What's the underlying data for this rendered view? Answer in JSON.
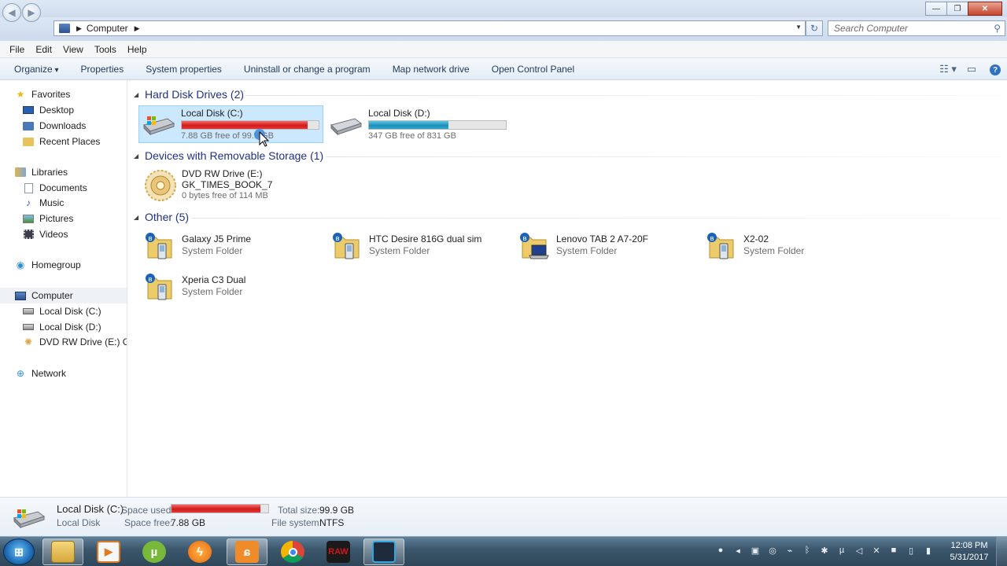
{
  "window": {
    "minimize": "—",
    "restore": "❐",
    "close": "✕"
  },
  "address": {
    "crumb": "Computer",
    "back": "◀",
    "forward": "▶",
    "refresh": "↻",
    "search_placeholder": "Search Computer"
  },
  "menu": [
    "File",
    "Edit",
    "View",
    "Tools",
    "Help"
  ],
  "toolbar": {
    "organize": "Organize",
    "commands": [
      "Properties",
      "System properties",
      "Uninstall or change a program",
      "Map network drive",
      "Open Control Panel"
    ]
  },
  "nav": {
    "favorites": "Favorites",
    "desktop": "Desktop",
    "downloads": "Downloads",
    "recent": "Recent Places",
    "libraries": "Libraries",
    "documents": "Documents",
    "music": "Music",
    "pictures": "Pictures",
    "videos": "Videos",
    "homegroup": "Homegroup",
    "computer": "Computer",
    "disk_c": "Local Disk (C:)",
    "disk_d": "Local Disk (D:)",
    "dvd": "DVD RW Drive (E:) GK_T",
    "network": "Network"
  },
  "groups": {
    "hdd": "Hard Disk Drives (2)",
    "removable": "Devices with Removable Storage (1)",
    "other": "Other (5)"
  },
  "drives": [
    {
      "name": "Local Disk (C:)",
      "free": "7.88 GB free of 99.9 GB",
      "used_fraction": 0.92,
      "bar_color": "#d21a1a"
    },
    {
      "name": "Local Disk (D:)",
      "free": "347 GB free of 831 GB",
      "used_fraction": 0.58,
      "bar_color": "#1d8fb8"
    }
  ],
  "dvd": {
    "line1": "DVD RW Drive (E:)",
    "line2": "GK_TIMES_BOOK_7",
    "line3": "0 bytes free of 114 MB"
  },
  "other_items": [
    {
      "name": "Galaxy J5 Prime",
      "type": "System Folder",
      "icon": "phone-folder-icon"
    },
    {
      "name": "HTC Desire 816G dual sim",
      "type": "System Folder",
      "icon": "phone-folder-icon"
    },
    {
      "name": "Lenovo TAB 2 A7-20F",
      "type": "System Folder",
      "icon": "laptop-folder-icon"
    },
    {
      "name": "X2-02",
      "type": "System Folder",
      "icon": "phone-folder-icon"
    },
    {
      "name": "Xperia C3 Dual",
      "type": "System Folder",
      "icon": "phone-folder-icon"
    }
  ],
  "details": {
    "name": "Local Disk (C:)",
    "type": "Local Disk",
    "space_used_label": "Space used:",
    "space_used_fraction": 0.92,
    "space_free_label": "Space free:",
    "space_free": "7.88 GB",
    "total_label": "Total size:",
    "total": "99.9 GB",
    "fs_label": "File system:",
    "fs": "NTFS"
  },
  "taskbar": {
    "apps": [
      "explorer",
      "media-player",
      "utorrent",
      "flash",
      "uc-browser",
      "chrome",
      "raw",
      "screen-recorder"
    ],
    "time": "12:08 PM",
    "date": "5/31/2017"
  },
  "colors": {
    "group_header": "#1e3287",
    "selection": "#cce8ff",
    "disk_bar_red": "#d21a1a",
    "disk_bar_blue": "#1d8fb8"
  }
}
